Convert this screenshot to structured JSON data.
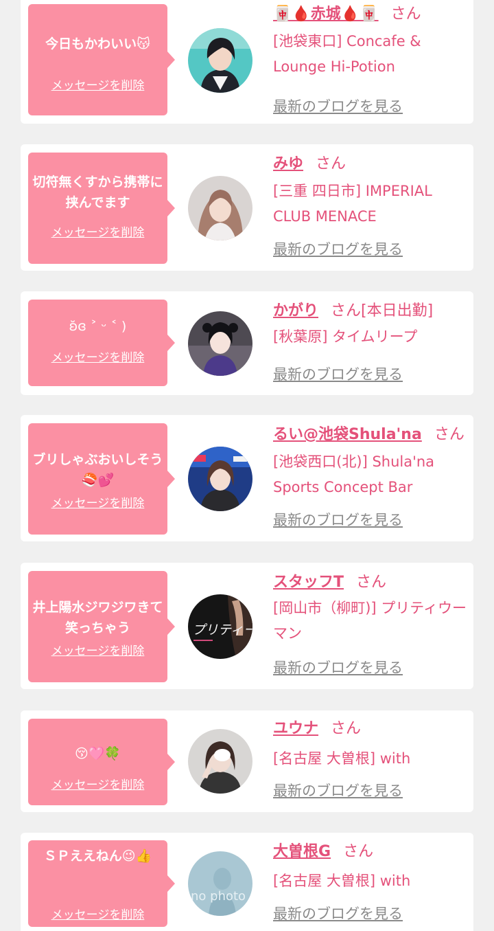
{
  "messages": [
    {
      "text": "今日もかわいい😽",
      "delete_label": "メッセージを削除",
      "name": "🀄🩸赤城🩸🀄",
      "honorific": "さん",
      "shop": "[池袋東口] Concafe & Lounge Hi-Potion",
      "blog_label": "最新のブログを見る",
      "avatar": "girl-short-hair-photo"
    },
    {
      "text": "切符無くすから携帯に挟んでます",
      "delete_label": "メッセージを削除",
      "name": "みゆ",
      "honorific": "さん",
      "shop": "[三重 四日市] IMPERIAL CLUB MENACE",
      "blog_label": "最新のブログを見る",
      "avatar": "girl-long-hair-photo"
    },
    {
      "text": "ʚ̆ɞ ˃ ᵕ ˂ )",
      "delete_label": "メッセージを削除",
      "name": "かがり",
      "honorific": "さん[本日出勤]",
      "shop": "[秋葉原] タイムリープ",
      "blog_label": "最新のブログを見る",
      "avatar": "girl-twin-tails-photo"
    },
    {
      "text": "ブリしゃぶおいしそう🍣💕",
      "delete_label": "メッセージを削除",
      "name": "るい@池袋Shula'na",
      "honorific": "さん",
      "shop": "[池袋西口(北)] Shula'na Sports Concept Bar",
      "blog_label": "最新のブログを見る",
      "avatar": "girl-stadium-photo"
    },
    {
      "text": "井上陽水ジワジワきて笑っちゃう",
      "delete_label": "メッセージを削除",
      "name": "スタッフT",
      "honorific": "さん",
      "shop": "[岡山市（柳町)] プリティウーマン",
      "blog_label": "最新のブログを見る",
      "avatar": "pretty-woman-logo",
      "avatar_text": "プリティーウーマ"
    },
    {
      "text": "😚🩷🍀",
      "delete_label": "メッセージを削除",
      "name": "ユウナ",
      "honorific": "さん",
      "shop": "[名古屋 大曽根] with",
      "blog_label": "最新のブログを見る",
      "avatar": "girl-hand-pose-photo"
    },
    {
      "text": "ＳＰええねん😉👍",
      "delete_label": "メッセージを削除",
      "name": "大曽根G",
      "honorific": "さん",
      "shop": "[名古屋 大曽根] with",
      "blog_label": "最新のブログを見る",
      "avatar": "no-photo-placeholder",
      "avatar_text": "no photo"
    }
  ],
  "colors": {
    "background": "#f0f0f0",
    "card": "#ffffff",
    "bubble": "#fb90a3",
    "accent_text": "#e4517a",
    "link_gray": "#8a8a8a"
  }
}
